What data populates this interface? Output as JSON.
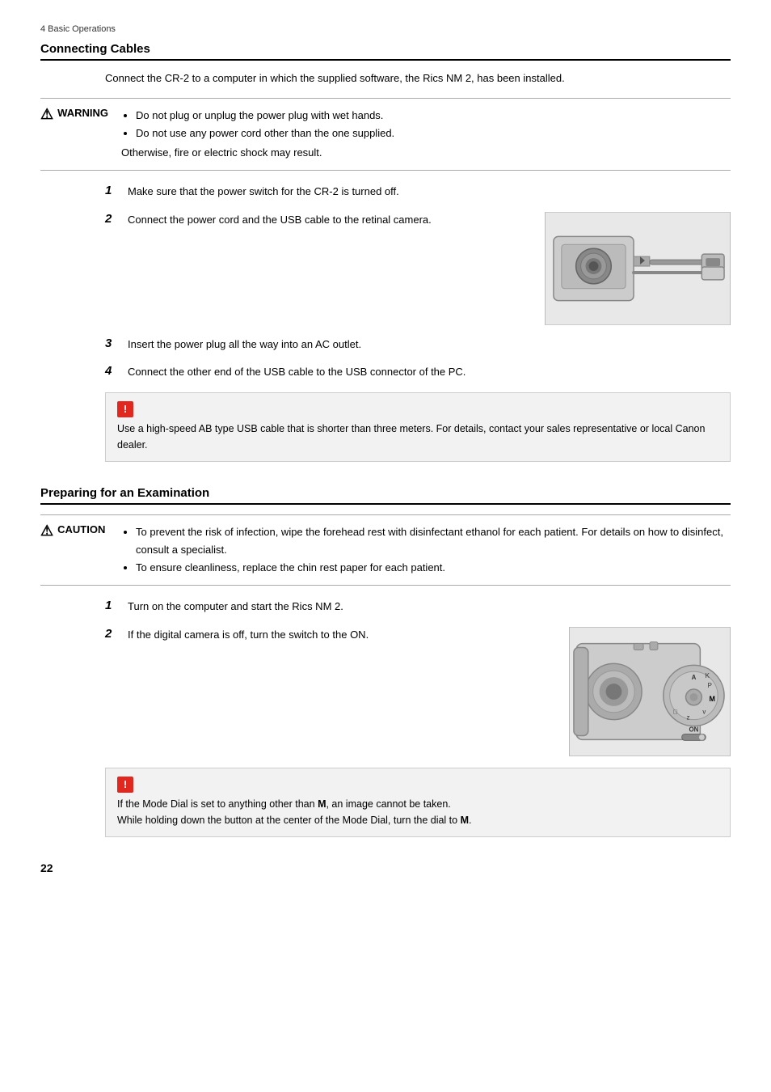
{
  "pageHeader": "4 Basic Operations",
  "section1": {
    "title": "Connecting Cables",
    "intro": "Connect the CR-2 to a computer in which the supplied software, the Rics NM 2, has been installed.",
    "warning": {
      "label": "WARNING",
      "bullets": [
        "Do not plug or unplug the power plug with wet hands.",
        "Do not use any power cord other than the one supplied."
      ],
      "otherwise": "Otherwise, fire or electric shock may result."
    },
    "steps": [
      {
        "num": "1",
        "text": "Make sure that the power switch for the CR-2 is turned off."
      },
      {
        "num": "2",
        "text": "Connect the power cord and the USB cable to the retinal camera.",
        "hasImage": true
      },
      {
        "num": "3",
        "text": "Insert the power plug all the way into an AC outlet."
      },
      {
        "num": "4",
        "text": "Connect the other end of the USB cable to the USB connector of the PC."
      }
    ],
    "note": "Use a high-speed AB type USB cable that is shorter than three meters. For details, contact your sales representative or local Canon dealer."
  },
  "section2": {
    "title": "Preparing for an Examination",
    "caution": {
      "label": "CAUTION",
      "bullets": [
        "To prevent the risk of infection, wipe the forehead rest with disinfectant ethanol for each patient. For details on how to disinfect, consult a specialist.",
        "To ensure cleanliness, replace the chin rest paper for each patient."
      ]
    },
    "steps": [
      {
        "num": "1",
        "text": "Turn on the computer and start the Rics NM 2."
      },
      {
        "num": "2",
        "text": "If the digital camera is off, turn the switch to the ON.",
        "hasImage": true
      }
    ],
    "note_line1": "If the Mode Dial is set to anything other than ",
    "note_m1": "M",
    "note_line2": ", an image cannot be taken.",
    "note_line3": "While holding down the button at the center of the Mode Dial, turn the dial to ",
    "note_m2": "M",
    "note_end": "."
  },
  "pageNumber": "22"
}
